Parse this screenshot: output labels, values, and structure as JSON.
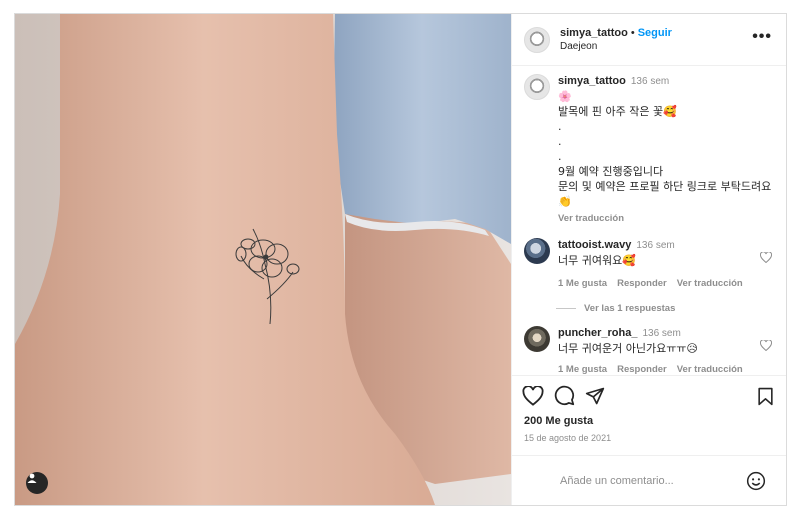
{
  "post": {
    "author": "simya_tattoo",
    "follow_label": "Seguir",
    "location": "Daejeon",
    "caption": {
      "author": "simya_tattoo",
      "time": "136 sem",
      "lines": "🌸\n발목에 핀 아주 작은 꽃🥰\n.\n.\n.\n9월 예약 진행중입니다\n문의 및 예약은 프로필 하단 링크로 부탁드려요👏",
      "translate": "Ver traducción"
    },
    "comments": [
      {
        "user": "tattooist.wavy",
        "time": "136 sem",
        "text": "너무 귀여워요🥰",
        "likes_label": "1 Me gusta",
        "reply_label": "Responder",
        "translate_label": "Ver traducción",
        "replies_label": "Ver las 1 respuestas"
      },
      {
        "user": "puncher_roha_",
        "time": "136 sem",
        "text": "너무 귀여운거 아닌가요ㅠㅠ😥",
        "likes_label": "1 Me gusta",
        "reply_label": "Responder",
        "translate_label": "Ver traducción"
      }
    ],
    "likes": "200 Me gusta",
    "date": "15 de agosto de 2021",
    "comment_placeholder": "Añade un comentario..."
  },
  "colors": {
    "link_blue": "#0095f6",
    "text": "#262626",
    "muted": "#8e8e8e",
    "border": "#dbdbdb"
  },
  "icons": [
    "more-icon",
    "heart-icon",
    "comment-icon",
    "share-icon",
    "bookmark-icon",
    "emoji-icon",
    "user-tag-icon"
  ]
}
